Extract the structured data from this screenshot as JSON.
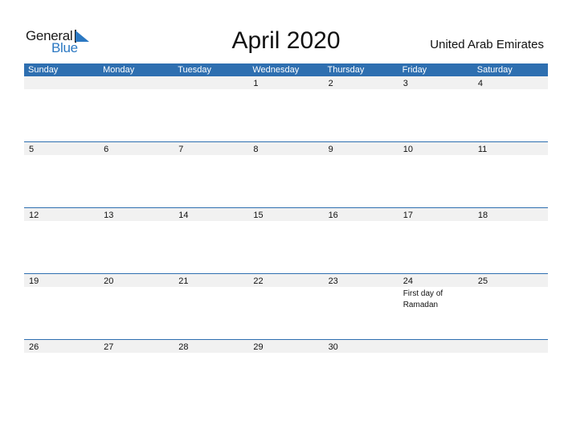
{
  "logo": {
    "line1": "General",
    "line2": "Blue",
    "brand_color": "#2b78c2"
  },
  "title": "April 2020",
  "country": "United Arab Emirates",
  "header_color": "#2e6fb0",
  "weekdays": [
    "Sunday",
    "Monday",
    "Tuesday",
    "Wednesday",
    "Thursday",
    "Friday",
    "Saturday"
  ],
  "weeks": [
    {
      "days": [
        {
          "num": ""
        },
        {
          "num": ""
        },
        {
          "num": ""
        },
        {
          "num": "1"
        },
        {
          "num": "2"
        },
        {
          "num": "3"
        },
        {
          "num": "4"
        }
      ]
    },
    {
      "days": [
        {
          "num": "5"
        },
        {
          "num": "6"
        },
        {
          "num": "7"
        },
        {
          "num": "8"
        },
        {
          "num": "9"
        },
        {
          "num": "10"
        },
        {
          "num": "11"
        }
      ]
    },
    {
      "days": [
        {
          "num": "12"
        },
        {
          "num": "13"
        },
        {
          "num": "14"
        },
        {
          "num": "15"
        },
        {
          "num": "16"
        },
        {
          "num": "17"
        },
        {
          "num": "18"
        }
      ]
    },
    {
      "days": [
        {
          "num": "19"
        },
        {
          "num": "20"
        },
        {
          "num": "21"
        },
        {
          "num": "22"
        },
        {
          "num": "23"
        },
        {
          "num": "24",
          "event": "First day of Ramadan"
        },
        {
          "num": "25"
        }
      ]
    },
    {
      "days": [
        {
          "num": "26"
        },
        {
          "num": "27"
        },
        {
          "num": "28"
        },
        {
          "num": "29"
        },
        {
          "num": "30"
        },
        {
          "num": ""
        },
        {
          "num": ""
        }
      ]
    }
  ]
}
